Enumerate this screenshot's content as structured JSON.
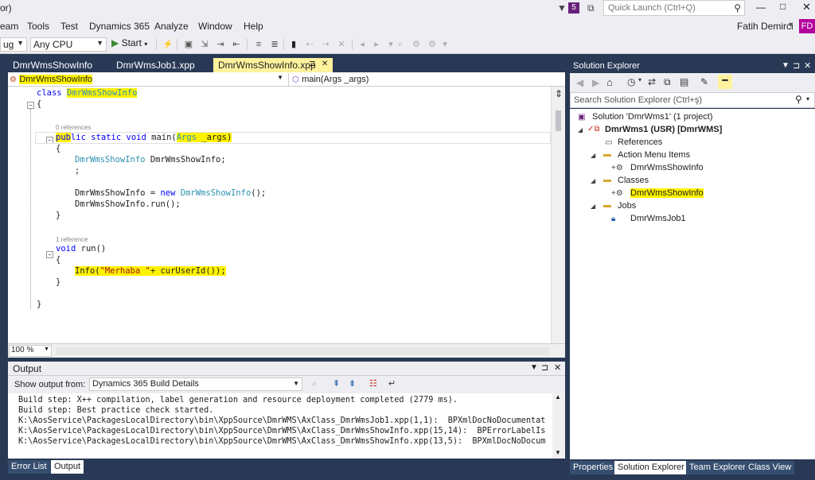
{
  "titlebar": {
    "notif_count": "5",
    "quick_launch_placeholder": "Quick Launch (Ctrl+Q)",
    "user_name": "Fatih Demirci",
    "user_initials": "FD",
    "title_fragment": "or)"
  },
  "menu": [
    "eam",
    "Tools",
    "Test",
    "Dynamics 365",
    "Analyze",
    "Window",
    "Help"
  ],
  "toolbar": {
    "config_value": "ug",
    "platform_value": "Any CPU",
    "start_label": "Start"
  },
  "editor": {
    "tabs": [
      {
        "label": "DmrWmsShowInfo"
      },
      {
        "label": "DmrWmsJob1.xpp"
      },
      {
        "label": "DmrWmsShowInfo.xpp",
        "pin": "⊐",
        "close": "✕"
      }
    ],
    "class_nav": "DmrWmsShowInfo",
    "method_nav": "main(Args _args)",
    "zoom": "100 %",
    "ref0": "0 references",
    "ref1": "1 reference",
    "lines": {
      "class_kw": "class",
      "class_name": "DmrWmsShowInfo",
      "brace_open": "{",
      "brace_close": "}",
      "main_pub_a": "pub",
      "main_pub_b": "lic static void",
      "main_name": "main(",
      "main_args": "Args",
      "main_rest": " _args)",
      "decl_type": "DmrWmsShowInfo",
      "decl_var": " DmrWmsShowInfo;",
      "semicolon": ";",
      "assign_a": "DmrWmsShowInfo = ",
      "assign_new": "new",
      "assign_type": "DmrWmsShowInfo",
      "assign_end": "();",
      "run_call": "DmrWmsShowInfo.run();",
      "void_kw": "void",
      "run_name": " run()",
      "info_a": "Info(",
      "info_str": "\"Merhaba \"",
      "info_b": "+ curUserId());"
    }
  },
  "output": {
    "title": "Output",
    "show_label": "Show output from:",
    "source": "Dynamics 365 Build Details",
    "lines": [
      "Build step: X++ compilation, label generation and resource deployment completed (2779 ms).",
      "Build step: Best practice check started.",
      "K:\\AosService\\PackagesLocalDirectory\\bin\\XppSource\\DmrWMS\\AxClass_DmrWmsJob1.xpp(1,1):  BPXmlDocNoDocumentat",
      "K:\\AosService\\PackagesLocalDirectory\\bin\\XppSource\\DmrWMS\\AxClass_DmrWmsShowInfo.xpp(15,14):  BPErrorLabelIs",
      "K:\\AosService\\PackagesLocalDirectory\\bin\\XppSource\\DmrWMS\\AxClass_DmrWmsShowInfo.xpp(13,5):  BPXmlDocNoDocum"
    ],
    "tabs": [
      "Error List",
      "Output"
    ]
  },
  "solution_explorer": {
    "title": "Solution Explorer",
    "search_placeholder": "Search Solution Explorer (Ctrl+ş)",
    "items": [
      {
        "label": "Solution 'DmrWms1' (1 project)"
      },
      {
        "label": "DmrWms1 (USR) [DmrWMS]"
      },
      {
        "label": "References"
      },
      {
        "label": "Action Menu Items"
      },
      {
        "label": "DmrWmsShowInfo"
      },
      {
        "label": "Classes"
      },
      {
        "label": "DmrWmsShowInfo"
      },
      {
        "label": "Jobs"
      },
      {
        "label": "DmrWmsJob1"
      }
    ],
    "tabs": [
      "Properties",
      "Solution Explorer",
      "Team Explorer",
      "Class View"
    ]
  },
  "colors": {
    "frame": "#293955",
    "highlight": "#fff200",
    "keyword": "#0000ff",
    "type": "#2b91af",
    "string": "#a31515",
    "active_tab": "#fff29d"
  }
}
